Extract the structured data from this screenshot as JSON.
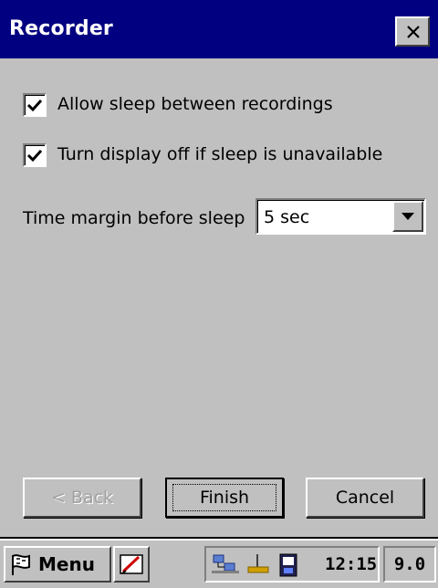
{
  "window": {
    "title": "Recorder"
  },
  "options": {
    "allow_sleep": {
      "label": "Allow sleep between recordings",
      "checked": true
    },
    "turn_display_off": {
      "label": "Turn display off if sleep is unavailable",
      "checked": true
    }
  },
  "time_margin": {
    "label": "Time margin before sleep",
    "value": "5 sec"
  },
  "buttons": {
    "back": "< Back",
    "finish": "Finish",
    "cancel": "Cancel"
  },
  "taskbar": {
    "start_label": "Menu",
    "clock": "12:15",
    "version": "9.0"
  },
  "colors": {
    "titlebar": "#000080",
    "face": "#c0c0c0"
  }
}
